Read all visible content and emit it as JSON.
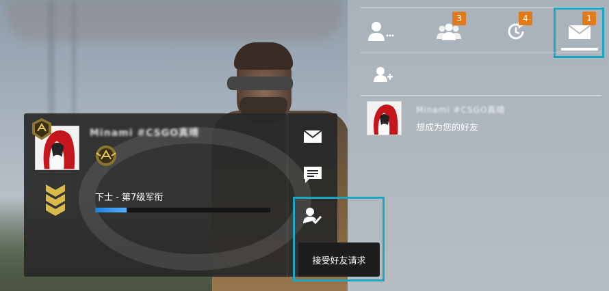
{
  "right_panel": {
    "tabs": [
      {
        "name": "friends",
        "icon": "person-icon",
        "badge": ""
      },
      {
        "name": "group",
        "icon": "group-icon",
        "badge": "3"
      },
      {
        "name": "activity",
        "icon": "refresh-icon",
        "badge": "4"
      },
      {
        "name": "mail",
        "icon": "mail-icon",
        "badge": "1"
      }
    ],
    "friend_request": {
      "name": "Minami #CSGO真晴",
      "message": "想成为您的好友"
    }
  },
  "card": {
    "player_name": "Minami #CSGO真晴",
    "rank_text": "下士 - 第7级军衔",
    "xp_progress": 0.18,
    "tooltip": "接受好友请求"
  },
  "colors": {
    "accent_highlight": "#1aa7c4",
    "badge": "#e07b1b",
    "xp_fill": "#2d8ee8",
    "card_bg": "#282828"
  }
}
